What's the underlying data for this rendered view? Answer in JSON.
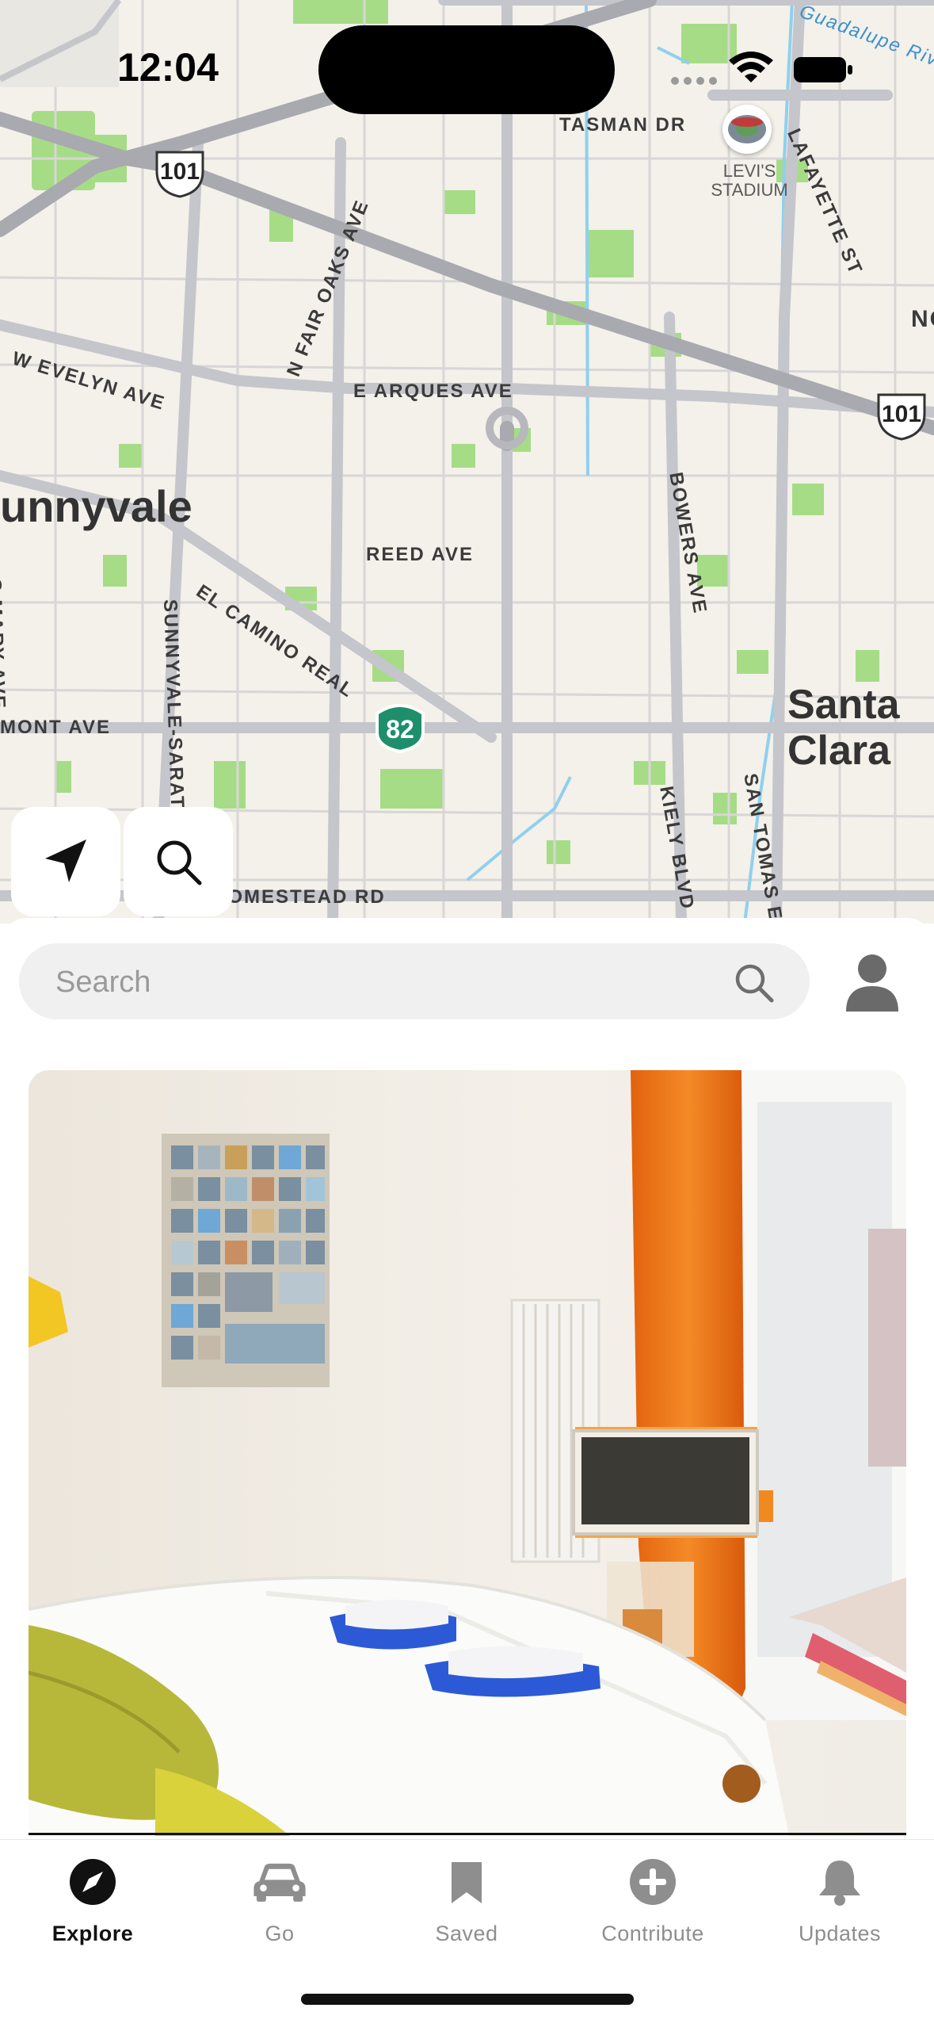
{
  "status_bar": {
    "time": "12:04"
  },
  "map": {
    "streets": [
      "TASMAN DR",
      "LAFAYETTE ST",
      "N FAIR OAKS AVE",
      "W EVELYN AVE",
      "E ARQUES AVE",
      "REED AVE",
      "EL CAMINO REAL",
      "BOWERS AVE",
      "KIELY BLVD",
      "SAN TOMAS EX",
      "SUNNYVALE-SARAT",
      "MONT AVE",
      "HOMESTEAD RD",
      "S MARY AVE"
    ],
    "cities": {
      "sunnyvale": "unnyvale",
      "santa_clara": "Santa\nClara"
    },
    "poi": {
      "stadium": "LEVI'S\nSTADIUM"
    },
    "shields": {
      "us101_a": "101",
      "us101_b": "101",
      "ca82": "82"
    },
    "river_label": "Guadalupe River",
    "edge_label": "NO",
    "colors": {
      "land": "#f3f1e9",
      "park": "#9fdb7d",
      "road": "#c9c9cf",
      "highway": "#a9a9b0",
      "water": "#8fd0ee"
    }
  },
  "search": {
    "placeholder": "Search"
  },
  "tabs": [
    {
      "label": "Explore",
      "icon": "compass-icon",
      "active": true
    },
    {
      "label": "Go",
      "icon": "car-icon",
      "active": false
    },
    {
      "label": "Saved",
      "icon": "bookmark-icon",
      "active": false
    },
    {
      "label": "Contribute",
      "icon": "plus-circle-icon",
      "active": false
    },
    {
      "label": "Updates",
      "icon": "bell-icon",
      "active": false
    }
  ]
}
